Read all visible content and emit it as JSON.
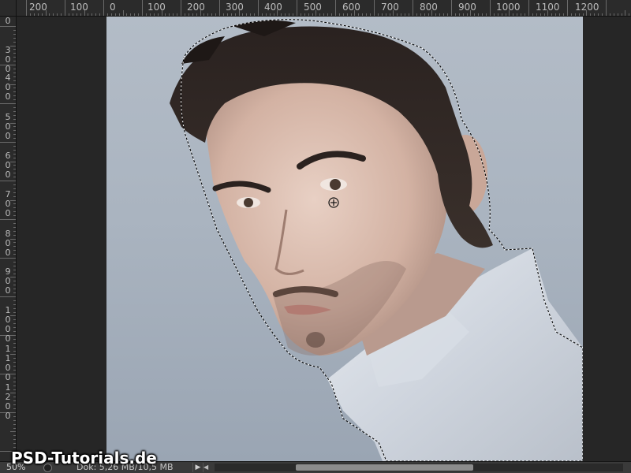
{
  "ruler": {
    "horizontal_labels": [
      "200",
      "100",
      "0",
      "100",
      "200",
      "300",
      "400",
      "500",
      "600",
      "700",
      "800",
      "900",
      "1000",
      "1100",
      "1200"
    ],
    "vertical_labels": [
      "0",
      "300",
      "400",
      "500",
      "600",
      "700",
      "800",
      "900",
      "1000",
      "1100",
      "1200"
    ]
  },
  "status_bar": {
    "zoom": "50%",
    "doc_size": "Dok: 5,26 MB/10,5 MB",
    "scroll_position_fraction": 0.35
  },
  "image": {
    "subject_icon": "portrait-photo",
    "selection": "marching-ants",
    "cursor_icon": "crosshair-cursor-icon"
  },
  "watermark": {
    "text": "PSD-Tutorials.de"
  },
  "colors": {
    "workspace_bg": "#262626",
    "ruler_bg": "#2b2b2b",
    "canvas_bg": "#aab4c0"
  }
}
